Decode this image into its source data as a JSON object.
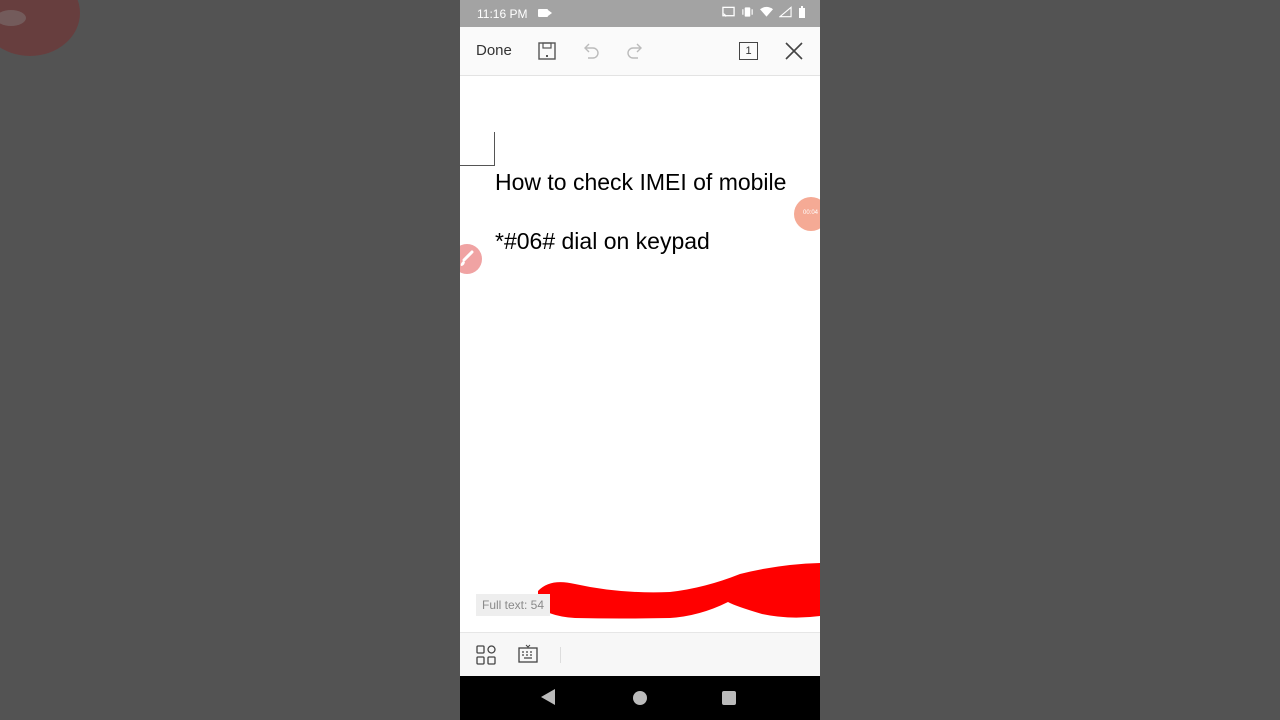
{
  "statusbar": {
    "time": "11:16 PM"
  },
  "toolbar": {
    "done_label": "Done",
    "page_count": "1"
  },
  "document": {
    "line1": "How to check IMEI of mobile",
    "line2": "*#06# dial on keypad"
  },
  "recording_badge": "00:04",
  "footer": {
    "full_text": "Full text: 54"
  },
  "colors": {
    "accent_red": "#ff0000",
    "statusbar_bg": "#a3a3a3",
    "backdrop": "#535353"
  },
  "icons": {
    "status": [
      "video-camera-icon",
      "cast-icon",
      "vibrate-icon",
      "wifi-icon",
      "signal-icon",
      "battery-icon"
    ],
    "toolbar": [
      "save-icon",
      "undo-icon",
      "redo-icon",
      "page-count-icon",
      "close-icon"
    ],
    "bottom": [
      "grid-icon",
      "keyboard-icon"
    ],
    "nav": [
      "back-icon",
      "home-icon",
      "recents-icon"
    ]
  }
}
